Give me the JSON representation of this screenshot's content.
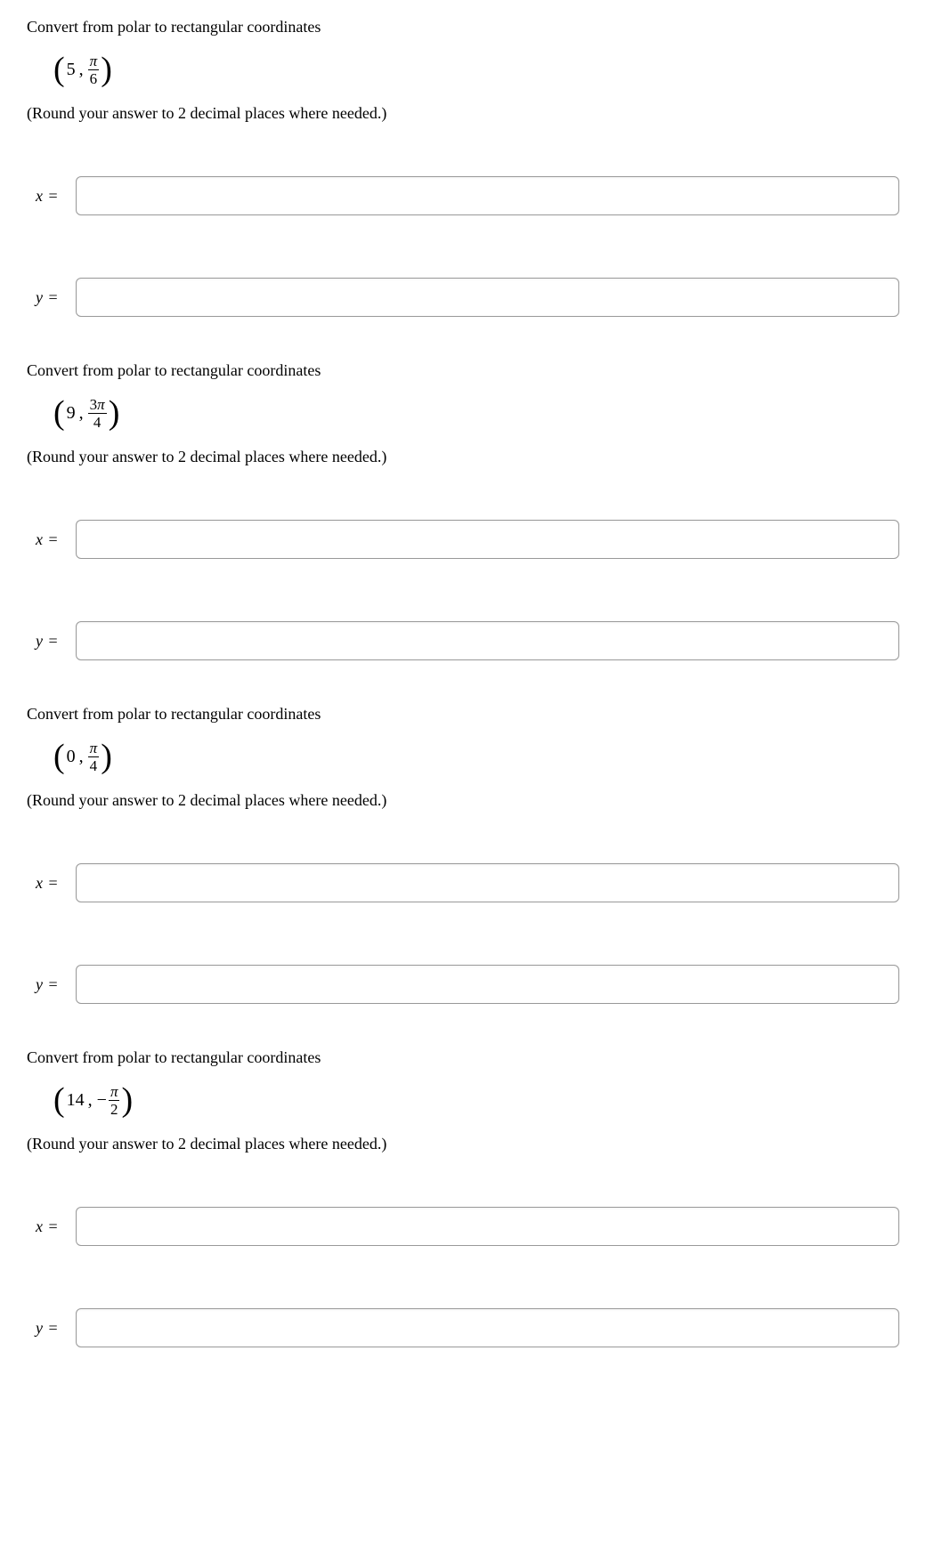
{
  "questions": [
    {
      "prompt": "Convert from polar to rectangular coordinates",
      "r": "5",
      "theta_num": "π",
      "theta_den": "6",
      "negative": false,
      "hint": "(Round your answer to 2 decimal places where needed.)",
      "x_label": "x",
      "y_label": "y",
      "eq": "="
    },
    {
      "prompt": "Convert from polar to rectangular coordinates",
      "r": "9",
      "theta_num": "3π",
      "theta_den": "4",
      "negative": false,
      "hint": "(Round your answer to 2 decimal places where needed.)",
      "x_label": "x",
      "y_label": "y",
      "eq": "="
    },
    {
      "prompt": "Convert from polar to rectangular coordinates",
      "r": "0",
      "theta_num": "π",
      "theta_den": "4",
      "negative": false,
      "hint": "(Round your answer to 2 decimal places where needed.)",
      "x_label": "x",
      "y_label": "y",
      "eq": "="
    },
    {
      "prompt": "Convert from polar to rectangular coordinates",
      "r": "14",
      "theta_num": "π",
      "theta_den": "2",
      "negative": true,
      "hint": "(Round your answer to 2 decimal places where needed.)",
      "x_label": "x",
      "y_label": "y",
      "eq": "="
    }
  ],
  "neg_sign": "−",
  "comma": ","
}
